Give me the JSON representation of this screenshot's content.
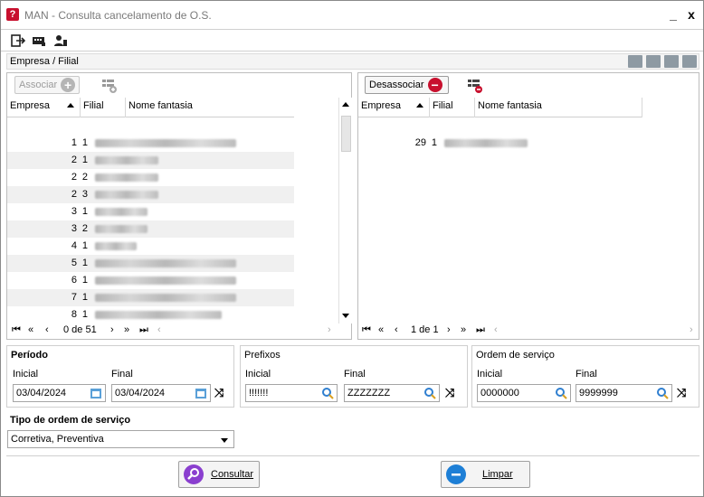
{
  "window": {
    "title": "MAN - Consulta cancelamento de O.S.",
    "minimize": "_",
    "close": "x"
  },
  "section": {
    "title": "Empresa / Filial"
  },
  "left_grid": {
    "button": "Associar",
    "columns": [
      "Empresa",
      "Filial",
      "Nome fantasia"
    ],
    "rows": [
      {
        "empresa": "1",
        "filial": "1"
      },
      {
        "empresa": "2",
        "filial": "1"
      },
      {
        "empresa": "2",
        "filial": "2"
      },
      {
        "empresa": "2",
        "filial": "3"
      },
      {
        "empresa": "3",
        "filial": "1"
      },
      {
        "empresa": "3",
        "filial": "2"
      },
      {
        "empresa": "4",
        "filial": "1"
      },
      {
        "empresa": "5",
        "filial": "1"
      },
      {
        "empresa": "6",
        "filial": "1"
      },
      {
        "empresa": "7",
        "filial": "1"
      },
      {
        "empresa": "8",
        "filial": "1"
      }
    ],
    "pager": "0 de 51"
  },
  "right_grid": {
    "button": "Desassociar",
    "columns": [
      "Empresa",
      "Filial",
      "Nome fantasia"
    ],
    "rows": [
      {
        "empresa": "29",
        "filial": "1"
      }
    ],
    "pager": "1 de 1"
  },
  "periodo": {
    "title": "Período",
    "inicial_label": "Inicial",
    "final_label": "Final",
    "inicial": "03/04/2024",
    "final": "03/04/2024"
  },
  "prefixos": {
    "title": "Prefixos",
    "inicial_label": "Inicial",
    "final_label": "Final",
    "inicial": "!!!!!!!",
    "final": "ZZZZZZZ"
  },
  "ordem": {
    "title": "Ordem de serviço",
    "inicial_label": "Inicial",
    "final_label": "Final",
    "inicial": "0000000",
    "final": "9999999"
  },
  "tipo": {
    "label": "Tipo de ordem de serviço",
    "value": "Corretiva, Preventiva"
  },
  "actions": {
    "consultar": "Consultar",
    "limpar": "Limpar"
  },
  "colors": {
    "accent_red": "#c8102e",
    "purple": "#8a3fcf",
    "blue": "#1e7fd6",
    "grey_plus": "#9a9a9a"
  }
}
